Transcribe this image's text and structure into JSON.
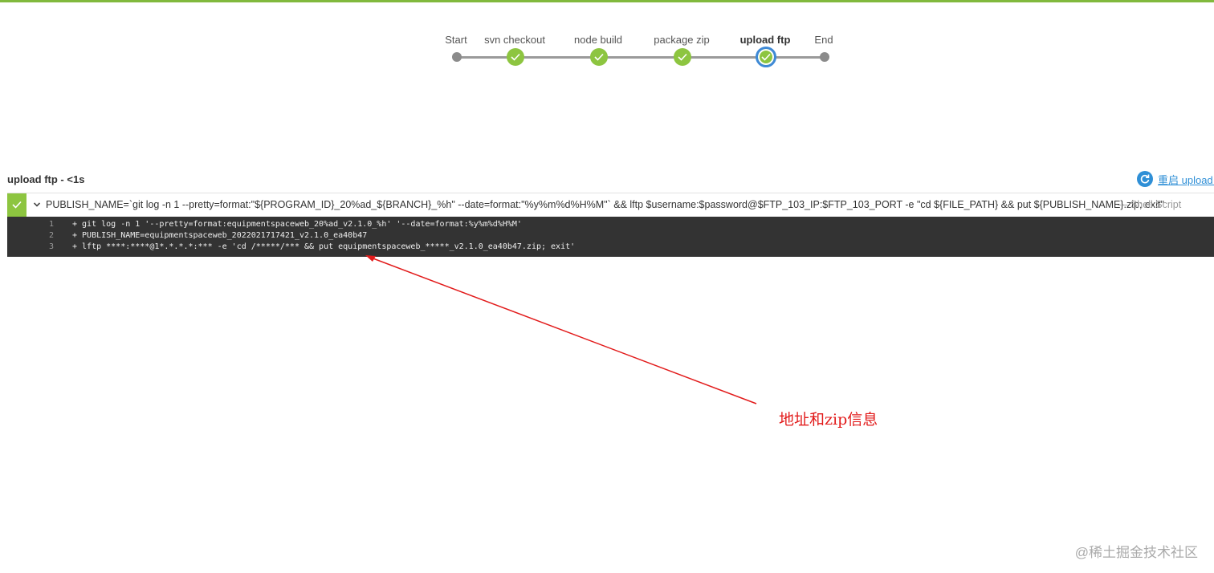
{
  "accent_color": "#81b93d",
  "pipeline": {
    "stages": [
      {
        "label": "Start",
        "status": "start"
      },
      {
        "label": "svn checkout",
        "status": "done"
      },
      {
        "label": "node build",
        "status": "done"
      },
      {
        "label": "package zip",
        "status": "done"
      },
      {
        "label": "upload ftp",
        "status": "current"
      },
      {
        "label": "End",
        "status": "end"
      }
    ]
  },
  "step": {
    "title": "upload ftp - <1s",
    "restart_label": "重启 upload ftp",
    "status_icon": "check-icon"
  },
  "command": {
    "text": "PUBLISH_NAME=`git log -n 1 --pretty=format:\"${PROGRAM_ID}_20%ad_${BRANCH}_%h\" --date=format:\"%y%m%d%H%M\"` && lftp $username:$password@$FTP_103_IP:$FTP_103_PORT -e \"cd ${FILE_PATH} && put ${PUBLISH_NAME}.zip; exit\"",
    "type": "— Shell Script"
  },
  "console": {
    "lines": [
      {
        "num": "1",
        "text": "+ git log -n 1 '--pretty=format:equipmentspaceweb_20%ad_v2.1.0_%h' '--date=format:%y%m%d%H%M'"
      },
      {
        "num": "2",
        "text": "+ PUBLISH_NAME=equipmentspaceweb_2022021717421_v2.1.0_ea40b47"
      },
      {
        "num": "3",
        "text": "+ lftp ****:****@1*.*.*.*:*** -e 'cd /*****/*** && put equipmentspaceweb_*****_v2.1.0_ea40b47.zip; exit'"
      }
    ]
  },
  "annotation": {
    "text": "地址和zip信息",
    "color": "#e21b1b"
  },
  "watermark": "@稀土掘金技术社区"
}
